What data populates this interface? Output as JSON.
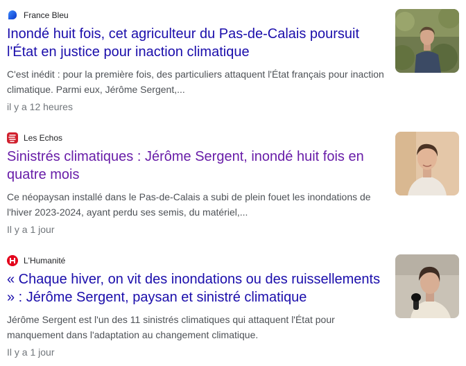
{
  "results": [
    {
      "source": "France Bleu",
      "source_icon": "france-bleu-logo-icon",
      "title": "Inondé huit fois, cet agriculteur du Pas-de-Calais poursuit l'État en justice pour inaction climatique",
      "snippet": "C'est inédit : pour la première fois, des particuliers attaquent l'État français pour inaction climatique. Parmi eux, Jérôme Sergent,...",
      "time": "il y a 12 heures",
      "thumbnail": "man-outdoors-photo"
    },
    {
      "source": "Les Echos",
      "source_icon": "les-echos-logo-icon",
      "title": "Sinistrés climatiques : Jérôme Sergent, inondé huit fois en quatre mois",
      "snippet": "Ce néopaysan installé dans le Pas-de-Calais a subi de plein fouet les inondations de l'hiver 2023-2024, ayant perdu ses semis, du matériel,...",
      "time": "Il y a 1 jour",
      "thumbnail": "man-portrait-photo"
    },
    {
      "source": "L'Humanité",
      "source_icon": "humanite-logo-icon",
      "title": "« Chaque hiver, on vit des inondations ou des ruissellements » : Jérôme Sergent, paysan et sinistré climatique",
      "snippet": "Jérôme Sergent est l'un des 11 sinistrés climatiques qui attaquent l'État pour manquement dans l'adaptation au changement climatique.",
      "time": "Il y a 1 jour",
      "thumbnail": "man-microphone-photo"
    }
  ],
  "colors": {
    "title_unvisited": "#1a0dab",
    "title_visited": "#681da8",
    "snippet": "#4d5156",
    "meta": "#70757a",
    "france_bleu": "#1054e8",
    "les_echos": "#d0202e",
    "humanite": "#e3001b"
  }
}
